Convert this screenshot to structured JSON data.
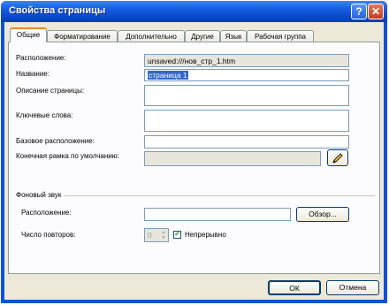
{
  "window": {
    "title": "Свойства страницы",
    "help_glyph": "?",
    "close_glyph": "✕"
  },
  "tabs": [
    {
      "label": "Общие",
      "active": true
    },
    {
      "label": "Форматирование",
      "active": false
    },
    {
      "label": "Дополнительно",
      "active": false
    },
    {
      "label": "Другие",
      "active": false
    },
    {
      "label": "Язык",
      "active": false
    },
    {
      "label": "Рабочая группа",
      "active": false
    }
  ],
  "general": {
    "location_label": "Расположение:",
    "location_value": "unsaved:///нов_стр_1.htm",
    "title_label": "Название:",
    "title_value": "страница 1",
    "description_label": "Описание страницы:",
    "description_value": "",
    "keywords_label": "Ключевые слова:",
    "keywords_value": "",
    "base_label": "Базовое расположение:",
    "base_value": "",
    "target_label": "Конечная рамка по умолчанию:",
    "target_value": ""
  },
  "sound": {
    "section_label": "Фоновый звук",
    "location_label": "Расположение:",
    "location_value": "",
    "browse_label": "Обзор...",
    "loop_label": "Число повторов:",
    "loop_value": "0",
    "continuous_label": "Непрерывно",
    "continuous_checked": true
  },
  "footer": {
    "ok_label": "ОК",
    "cancel_label": "Отмена"
  },
  "colors": {
    "titlebar": "#0846c8",
    "face": "#ece9d8",
    "active_tab_accent": "#e68b2c",
    "selection": "#316ac5"
  }
}
